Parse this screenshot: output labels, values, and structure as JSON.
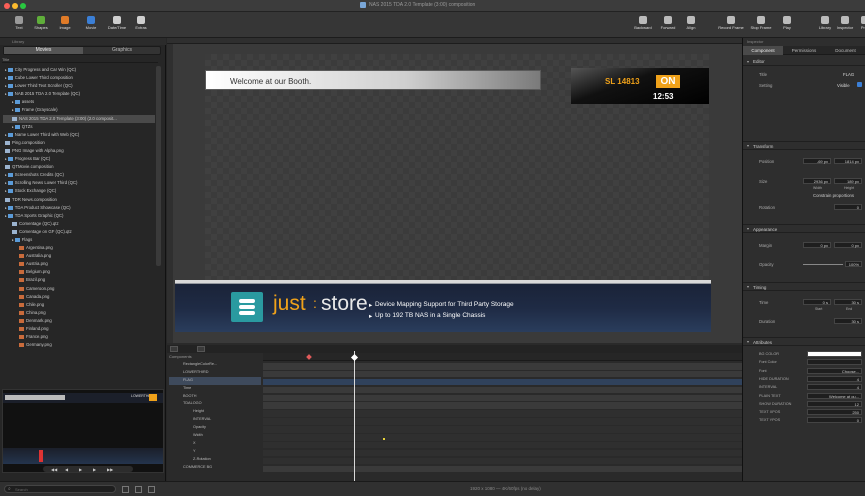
{
  "window": {
    "title": "NAS 2015 TDA 2.0 Template (3:00) composition"
  },
  "toolbar": {
    "left": [
      {
        "label": "Text",
        "icon": "text-icon",
        "color": "#9a9a9a"
      },
      {
        "label": "Shapes",
        "icon": "shapes-icon",
        "color": "#5fae3a"
      },
      {
        "label": "Image",
        "icon": "image-icon",
        "color": "#e07b28"
      },
      {
        "label": "Movie",
        "icon": "movie-icon",
        "color": "#3b7fd6"
      },
      {
        "label": "Date/Time",
        "icon": "clock-icon",
        "color": "#cfcfcf"
      },
      {
        "label": "Extras",
        "icon": "gear-icon",
        "color": "#cfcfcf"
      }
    ],
    "mid": [
      {
        "label": "Backward",
        "icon": "backward-icon"
      },
      {
        "label": "Forward",
        "icon": "forward-icon"
      },
      {
        "label": "Align",
        "icon": "align-icon"
      }
    ],
    "right": [
      {
        "label": "Record Frame",
        "icon": "record-frame-icon"
      },
      {
        "label": "Stop Frame",
        "icon": "stop-frame-icon"
      },
      {
        "label": "Play",
        "icon": "play-icon"
      },
      {
        "label": "Library",
        "icon": "library-icon"
      },
      {
        "label": "Inspector",
        "icon": "inspector-icon"
      },
      {
        "label": "Prev",
        "icon": "preview-icon"
      }
    ]
  },
  "library": {
    "header": "Library",
    "tabs": [
      "Movies",
      "Graphics"
    ],
    "column": "Title",
    "items": [
      {
        "label": "City Progress and Car Win (QC)",
        "type": "folder",
        "indent": 0
      },
      {
        "label": "Cube Lower Third composition",
        "type": "folder",
        "indent": 0
      },
      {
        "label": "Lower Third Text Scroller (QC)",
        "type": "folder",
        "indent": 0
      },
      {
        "label": "NAB 2015 TDA 2.0 Template (QC)",
        "type": "folder",
        "indent": 0
      },
      {
        "label": "assets",
        "type": "folder",
        "indent": 1
      },
      {
        "label": "Frame (Grayscale)",
        "type": "folder",
        "indent": 1
      },
      {
        "label": "NAS 2015 TDA 2.0 Template (3:00) (2.0 composit...",
        "type": "file",
        "indent": 1,
        "selected": true
      },
      {
        "label": "QTZs",
        "type": "folder",
        "indent": 1
      },
      {
        "label": "Name Lower Third with Web (QC)",
        "type": "folder",
        "indent": 0
      },
      {
        "label": "Ping.composition",
        "type": "file",
        "indent": 0
      },
      {
        "label": "PNG Image with Alpha.png",
        "type": "file",
        "indent": 0
      },
      {
        "label": "Progress Bar (QC)",
        "type": "folder",
        "indent": 0
      },
      {
        "label": "QTMovie.composition",
        "type": "file",
        "indent": 0
      },
      {
        "label": "Screenshots Credits (QC)",
        "type": "folder",
        "indent": 0
      },
      {
        "label": "Scrolling News Lower Third (QC)",
        "type": "folder",
        "indent": 0
      },
      {
        "label": "Stock Exchange (QC)",
        "type": "folder",
        "indent": 0
      },
      {
        "label": "TDR News.composition",
        "type": "file",
        "indent": 0
      },
      {
        "label": "TDA Product Showcase (QC)",
        "type": "folder",
        "indent": 0
      },
      {
        "label": "TDA Sports Graphic (QC)",
        "type": "folder",
        "indent": 0
      },
      {
        "label": "Comentage (QC).qtz",
        "type": "file",
        "indent": 1
      },
      {
        "label": "Comentage on GF (QC).qtz",
        "type": "file",
        "indent": 1
      },
      {
        "label": "Flags",
        "type": "folder",
        "indent": 1
      },
      {
        "label": "Argentina.png",
        "type": "image",
        "indent": 2
      },
      {
        "label": "Australia.png",
        "type": "image",
        "indent": 2
      },
      {
        "label": "Austria.png",
        "type": "image",
        "indent": 2
      },
      {
        "label": "Belgium.png",
        "type": "image",
        "indent": 2
      },
      {
        "label": "Brazil.png",
        "type": "image",
        "indent": 2
      },
      {
        "label": "Cameroon.png",
        "type": "image",
        "indent": 2
      },
      {
        "label": "Canada.png",
        "type": "image",
        "indent": 2
      },
      {
        "label": "Chile.png",
        "type": "image",
        "indent": 2
      },
      {
        "label": "China.png",
        "type": "image",
        "indent": 2
      },
      {
        "label": "Denmark.png",
        "type": "image",
        "indent": 2
      },
      {
        "label": "Finland.png",
        "type": "image",
        "indent": 2
      },
      {
        "label": "France.png",
        "type": "image",
        "indent": 2
      },
      {
        "label": "Germany.png",
        "type": "image",
        "indent": 2
      }
    ],
    "search_placeholder": "Search"
  },
  "canvas": {
    "welcome_text": "Welcome at our Booth.",
    "sl_label": "SL 14813",
    "on_label": "ON",
    "clock": "12:53",
    "brand_just": "just",
    "brand_store": "store",
    "bullets": [
      "Device Mapping Support for Third Party Storage",
      "Up to 192 TB NAS in a Single Chassis"
    ]
  },
  "timeline": {
    "header": "Components",
    "rows": [
      "RectangleColorRe...",
      "LOWERTHIRD",
      "FLAG",
      "Time",
      "BOOTH",
      "TDALOGO",
      "Height",
      "INTERVAL",
      "Opacity",
      "Width",
      "X",
      "Y",
      "Z-Rotation",
      "COMMERCE BG"
    ]
  },
  "inspector": {
    "header": "Inspector",
    "tabs": [
      "Component",
      "Permissions",
      "Document"
    ],
    "editor": {
      "title": "Editor",
      "name_label": "Title",
      "name_value": "FLAG",
      "setting_label": "Setting",
      "setting_value": "Visible"
    },
    "transform": {
      "title": "Transform",
      "position_label": "Position",
      "pos_x": "-69 px",
      "pos_y": "1814 px",
      "size_label": "Size",
      "w": "2936 px",
      "h": "189 px",
      "w_unit": "Width",
      "h_unit": "Height",
      "constrain": "Constrain proportions",
      "rotation_label": "Rotation",
      "rotation": "0"
    },
    "appearance": {
      "title": "Appearance",
      "margin_label": "Margin",
      "margin_a": "0 px",
      "margin_b": "0 px",
      "opacity_label": "Opacity",
      "opacity": "100%"
    },
    "timing": {
      "title": "Timing",
      "time_label": "Time",
      "start": "0 s",
      "end": "30 s",
      "start_unit": "Start",
      "end_unit": "End",
      "duration_label": "Duration",
      "duration": "30 s"
    },
    "attributes": {
      "title": "Attributes",
      "items": [
        {
          "label": "BG COLOR",
          "value": ""
        },
        {
          "label": "Font Color",
          "value": ""
        },
        {
          "label": "Font",
          "value": "Choose..."
        },
        {
          "label": "HIDE DURATION",
          "value": "4"
        },
        {
          "label": "INTERVAL",
          "value": "4"
        },
        {
          "label": "PLAIN TEXT",
          "value": "Welcome at ou..."
        },
        {
          "label": "SHOW DURATION",
          "value": "12"
        },
        {
          "label": "TEXT XPOS",
          "value": "250"
        },
        {
          "label": "TEXT YPOS",
          "value": "0"
        }
      ]
    }
  },
  "status": {
    "text": "1920 x 1080 — 4K/60fps (no delay)"
  },
  "preview": {
    "label": "LOWERTHIRD"
  }
}
